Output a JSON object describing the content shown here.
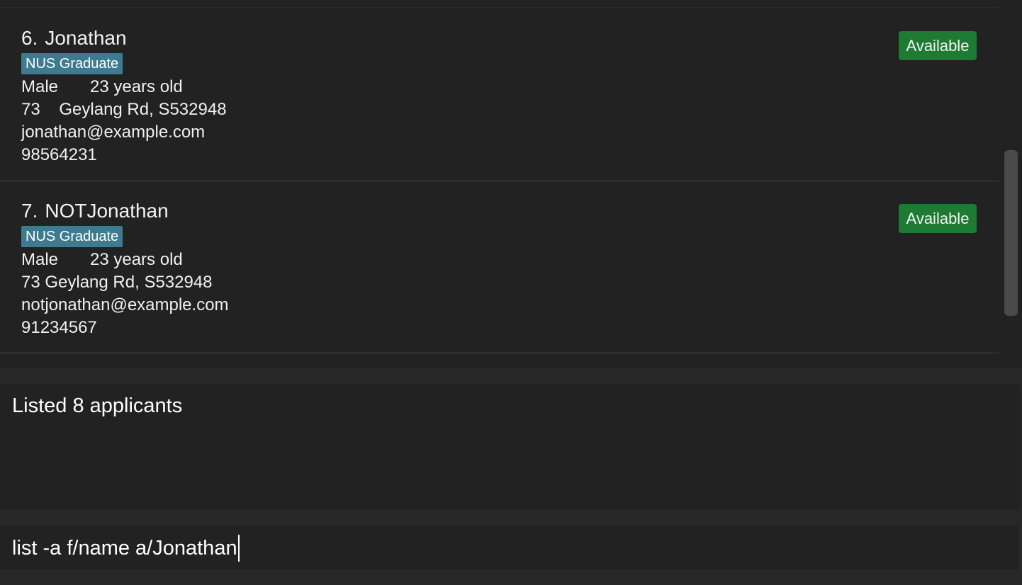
{
  "applicants": [
    {
      "index": "6.",
      "name": "Jonathan",
      "tag": "NUS Graduate",
      "gender": "Male",
      "age": "23 years old",
      "address": "73    Geylang Rd, S532948",
      "email": "jonathan@example.com",
      "phone": "98564231",
      "status": "Available"
    },
    {
      "index": "7.",
      "name": "NOTJonathan",
      "tag": "NUS Graduate",
      "gender": "Male",
      "age": "23 years old",
      "address": "73 Geylang Rd, S532948",
      "email": "notjonathan@example.com",
      "phone": "91234567",
      "status": "Available"
    }
  ],
  "result": {
    "message": "Listed 8 applicants"
  },
  "command": {
    "value": "list -a f/name a/Jonathan"
  },
  "colors": {
    "background": "#222222",
    "tag": "#3e7b91",
    "status_available": "#1e7b34",
    "scrollbar_thumb": "#4a4a4a"
  }
}
